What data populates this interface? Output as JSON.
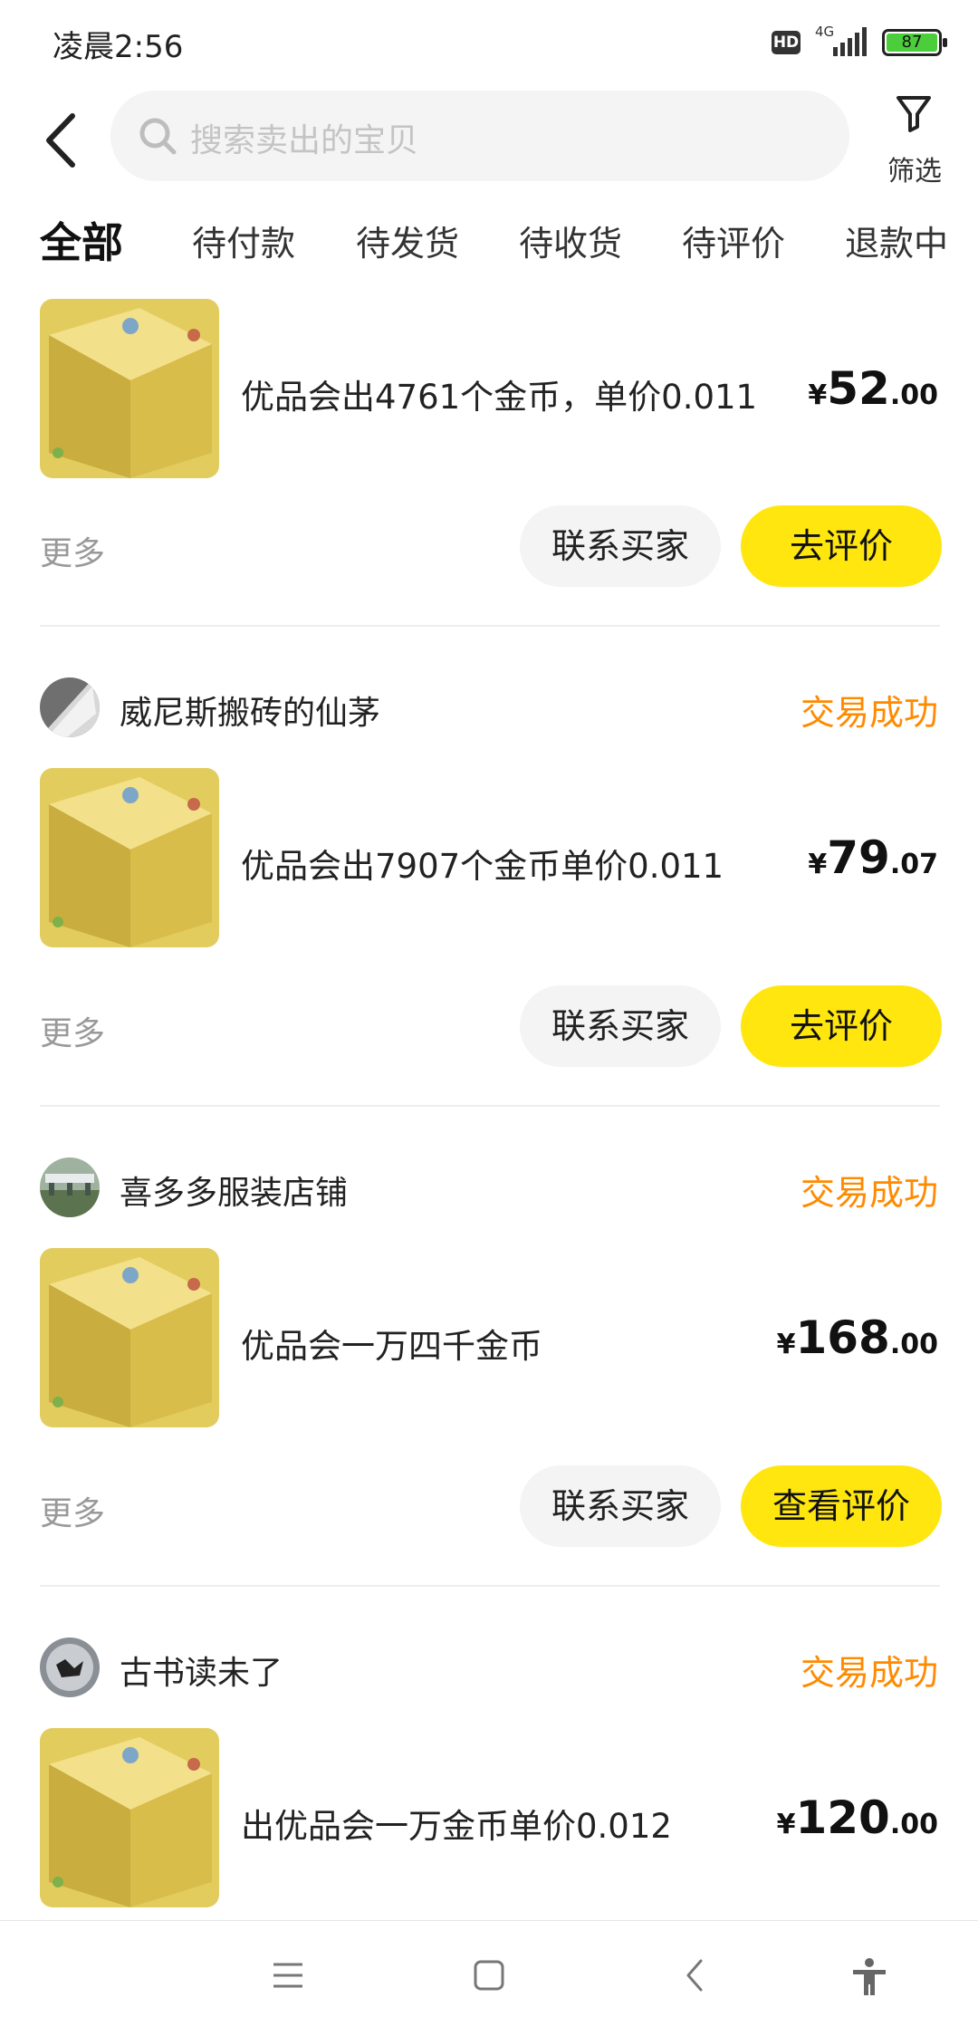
{
  "status_bar": {
    "time": "凌晨2:56",
    "hd": "HD",
    "network": "4G",
    "battery": "87"
  },
  "search": {
    "placeholder": "搜索卖出的宝贝"
  },
  "filter": {
    "label": "筛选"
  },
  "tabs": [
    {
      "label": "全部",
      "active": true
    },
    {
      "label": "待付款"
    },
    {
      "label": "待发货"
    },
    {
      "label": "待收货"
    },
    {
      "label": "待评价"
    },
    {
      "label": "退款中"
    }
  ],
  "orders": [
    {
      "item_title": "优品会出4761个金币，单价0.011",
      "price_symbol": "¥",
      "price_int": "52",
      "price_dec": ".00",
      "more": "更多",
      "contact_btn": "联系买家",
      "action_btn": "去评价"
    },
    {
      "seller": "威尼斯搬砖的仙茅",
      "status": "交易成功",
      "item_title": "优品会出7907个金币单价0.011",
      "price_symbol": "¥",
      "price_int": "79",
      "price_dec": ".07",
      "more": "更多",
      "contact_btn": "联系买家",
      "action_btn": "去评价"
    },
    {
      "seller": "喜多多服装店铺",
      "status": "交易成功",
      "item_title": "优品会一万四千金币",
      "price_symbol": "¥",
      "price_int": "168",
      "price_dec": ".00",
      "more": "更多",
      "contact_btn": "联系买家",
      "action_btn": "查看评价"
    },
    {
      "seller": "古书读未了",
      "status": "交易成功",
      "item_title": "出优品会一万金币单价0.012",
      "price_symbol": "¥",
      "price_int": "120",
      "price_dec": ".00"
    }
  ],
  "colors": {
    "accent": "#ffe60f",
    "status": "#ff8a00",
    "muted": "#999999"
  },
  "icons": [
    "back-arrow-icon",
    "search-icon",
    "filter-funnel-icon",
    "menu-icon",
    "home-square-icon",
    "nav-back-icon",
    "accessibility-icon"
  ]
}
